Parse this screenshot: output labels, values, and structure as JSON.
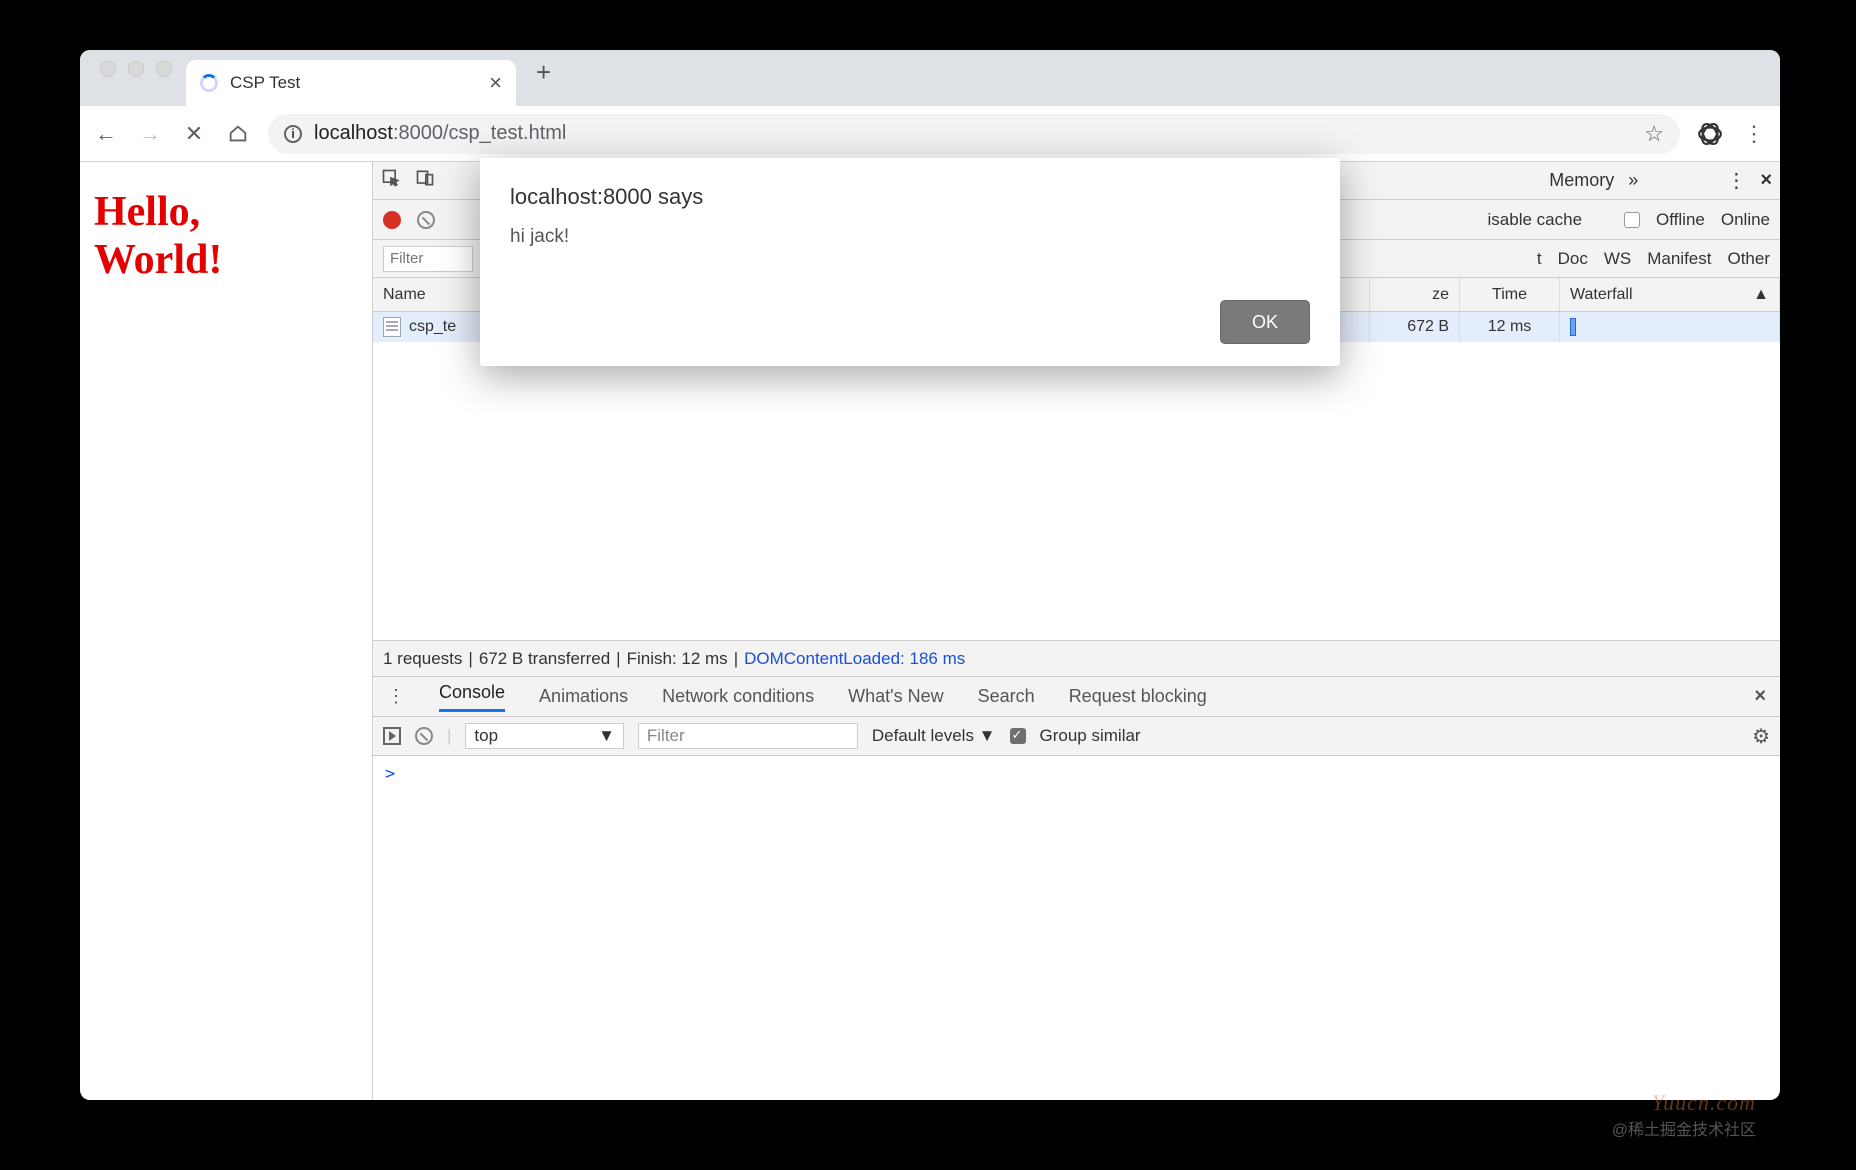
{
  "browser": {
    "tab_title": "CSP Test",
    "url_host": "localhost",
    "url_port": ":8000",
    "url_path": "/csp_test.html"
  },
  "page": {
    "heading_line1": "Hello,",
    "heading_line2": "World!"
  },
  "alert": {
    "title": "localhost:8000 says",
    "message": "hi jack!",
    "ok": "OK"
  },
  "devtools": {
    "tabs": {
      "memory": "Memory"
    },
    "network": {
      "disable_cache": "isable cache",
      "offline": "Offline",
      "online": "Online",
      "filter_placeholder": "Filter",
      "types": {
        "t": "t",
        "doc": "Doc",
        "ws": "WS",
        "manifest": "Manifest",
        "other": "Other"
      },
      "headers": {
        "name": "Name",
        "size": "ze",
        "time": "Time",
        "waterfall": "Waterfall"
      },
      "row": {
        "name": "csp_te",
        "size": "672 B",
        "time": "12 ms"
      },
      "status": {
        "requests": "1 requests",
        "transferred": "672 B transferred",
        "finish": "Finish: 12 ms",
        "dcl": "DOMContentLoaded: 186 ms"
      }
    },
    "drawer": {
      "console": "Console",
      "animations": "Animations",
      "network_conditions": "Network conditions",
      "whats_new": "What's New",
      "search": "Search",
      "request_blocking": "Request blocking"
    },
    "console": {
      "context": "top",
      "filter_placeholder": "Filter",
      "levels": "Default levels",
      "group": "Group similar",
      "prompt": ">"
    }
  },
  "watermark": {
    "brand": "Yuucn.com",
    "credit": "@稀土掘金技术社区"
  }
}
